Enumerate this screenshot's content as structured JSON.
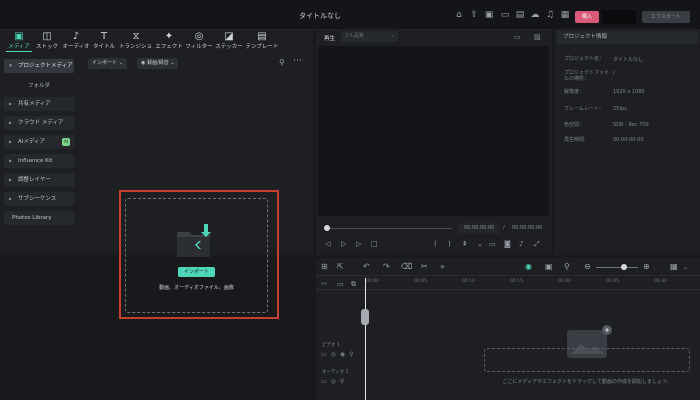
{
  "window": {
    "title": "タイトルなし",
    "buy_label": "購入",
    "export_label": "エクスポート"
  },
  "library": {
    "tabs": [
      {
        "label": "メディア",
        "icon": "media-icon"
      },
      {
        "label": "ストック",
        "icon": "stock-icon"
      },
      {
        "label": "オーディオ",
        "icon": "audio-icon"
      },
      {
        "label": "タイトル",
        "icon": "title-icon"
      },
      {
        "label": "トランジション",
        "icon": "transition-icon"
      },
      {
        "label": "エフェクト",
        "icon": "effect-icon"
      },
      {
        "label": "フィルター",
        "icon": "filter-icon"
      },
      {
        "label": "ステッカー",
        "icon": "sticker-icon"
      },
      {
        "label": "テンプレート",
        "icon": "template-icon"
      }
    ],
    "sidebar": {
      "project_media": "プロジェクトメディア",
      "folder": "フォルダ",
      "shared_media": "共有メディア",
      "cloud_media": "クラウド メディア",
      "ai_media": "AIメディア",
      "ai_badge": "AI",
      "influence_kit": "Influence Kit",
      "adjustment_layer": "調整レイヤー",
      "subsequence": "サブシーケンス",
      "photos_library": "Photos Library"
    },
    "import_dropdown": "インポート",
    "record_dropdown": "録画/録音",
    "import_button": "インポート",
    "drop_hint": "動画、オーディオファイル、画像"
  },
  "player": {
    "label": "再生",
    "quality": "フル品質",
    "current_time": "00:00:00:00",
    "separator": "/",
    "total_time": "00:00:00:00"
  },
  "properties": {
    "header": "プロジェクト情報",
    "rows": [
      {
        "key": "プロジェクト名：",
        "value": "タイトルなし"
      },
      {
        "key": "プロジェクトファイルの場所：",
        "value": "/"
      },
      {
        "key": "解像度：",
        "value": "1920 x 1080"
      },
      {
        "key": "フレームレート：",
        "value": "25fps"
      },
      {
        "key": "色空間：",
        "value": "SDR - Rec.709"
      },
      {
        "key": "再生時間：",
        "value": "00:00:00:00"
      }
    ]
  },
  "timeline": {
    "ruler": [
      "00:00",
      "00:05",
      "00:10",
      "00:15",
      "00:20",
      "00:25",
      "00:30"
    ],
    "video_track": "ビデオ 1",
    "audio_track": "オーディオ 1",
    "drop_hint": "ここにメディアやエフェクトをドラッグして動画の作成を開始しましょう。"
  },
  "colors": {
    "accent": "#4fd6b9",
    "buy": "#d95a78",
    "highlight_border": "#c3402e"
  }
}
